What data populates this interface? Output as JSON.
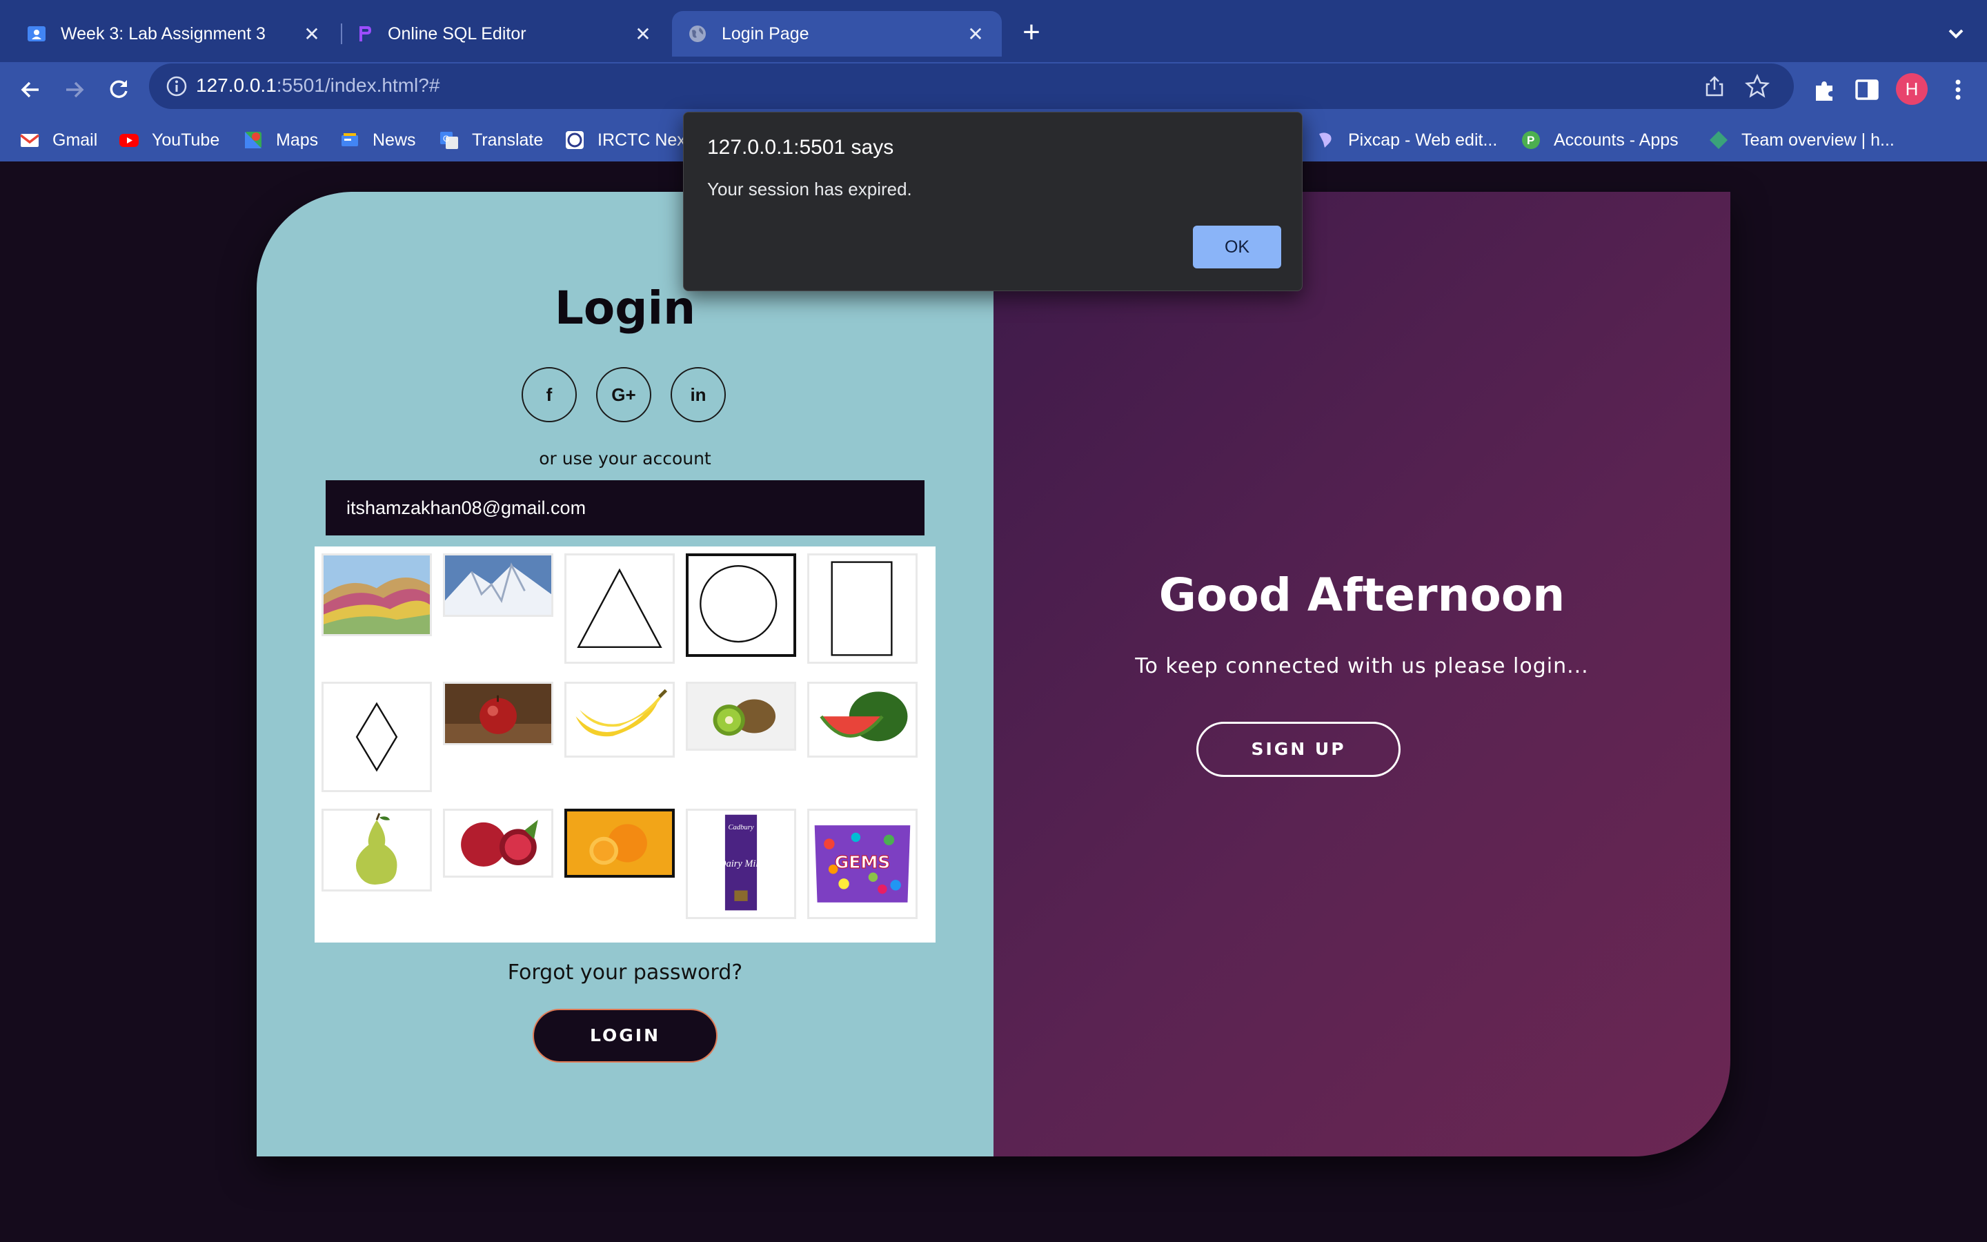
{
  "browser": {
    "tabs": [
      {
        "label": "Week 3: Lab Assignment 3",
        "icon": "classroom-icon",
        "active": false
      },
      {
        "label": "Online SQL Editor",
        "icon": "sql-editor-icon",
        "active": false
      },
      {
        "label": "Login Page",
        "icon": "globe-icon",
        "active": true
      }
    ],
    "url_host": "127.0.0.1",
    "url_rest": ":5501/index.html?#",
    "profile_initial": "H",
    "bookmarks": [
      {
        "label": "Gmail",
        "icon": "gmail-icon"
      },
      {
        "label": "YouTube",
        "icon": "youtube-icon"
      },
      {
        "label": "Maps",
        "icon": "maps-icon"
      },
      {
        "label": "News",
        "icon": "news-icon"
      },
      {
        "label": "Translate",
        "icon": "translate-icon"
      },
      {
        "label": "IRCTC Nex",
        "icon": "irctc-icon"
      },
      {
        "label": "Pixcap - Web edit...",
        "icon": "pixcap-icon"
      },
      {
        "label": "Accounts - Apps",
        "icon": "accounts-icon"
      },
      {
        "label": "Team overview | h...",
        "icon": "team-icon"
      }
    ]
  },
  "login": {
    "title": "Login",
    "socials": [
      "f",
      "G+",
      "in"
    ],
    "or_text": "or use your account",
    "email_value": "itshamzakhan08@gmail.com",
    "grid": [
      {
        "name": "rainbow-mountains-image",
        "selected": false
      },
      {
        "name": "snowy-mountain-image",
        "selected": false
      },
      {
        "name": "triangle-shape",
        "selected": false
      },
      {
        "name": "circle-shape",
        "selected": true
      },
      {
        "name": "rectangle-shape",
        "selected": false
      },
      {
        "name": "diamond-shape",
        "selected": false
      },
      {
        "name": "apple-image",
        "selected": false
      },
      {
        "name": "bananas-image",
        "selected": false
      },
      {
        "name": "kiwi-image",
        "selected": false
      },
      {
        "name": "watermelon-image",
        "selected": false
      },
      {
        "name": "pear-image",
        "selected": false
      },
      {
        "name": "pomegranate-image",
        "selected": false
      },
      {
        "name": "orange-image",
        "selected": true
      },
      {
        "name": "dairy-milk-image",
        "selected": false
      },
      {
        "name": "gems-image",
        "selected": false
      }
    ],
    "chocolate_label": "Dairy Milk",
    "chocolate_brand": "Cadbury",
    "gems_label": "GEMS",
    "forgot": "Forgot your password?",
    "login_button": "LOGIN"
  },
  "welcome": {
    "greeting": "Good Afternoon",
    "subtitle": "To keep connected with us please login...",
    "signup_button": "SIGN UP"
  },
  "dialog": {
    "title": "127.0.0.1:5501 says",
    "message": "Your session has expired.",
    "ok_label": "OK"
  },
  "colors": {
    "left_panel": "#94c7cf",
    "right_panel": "#5a2352",
    "page_bg": "#150b1c",
    "chrome": "#3553a8",
    "dialog_button": "#8ab4f8"
  }
}
